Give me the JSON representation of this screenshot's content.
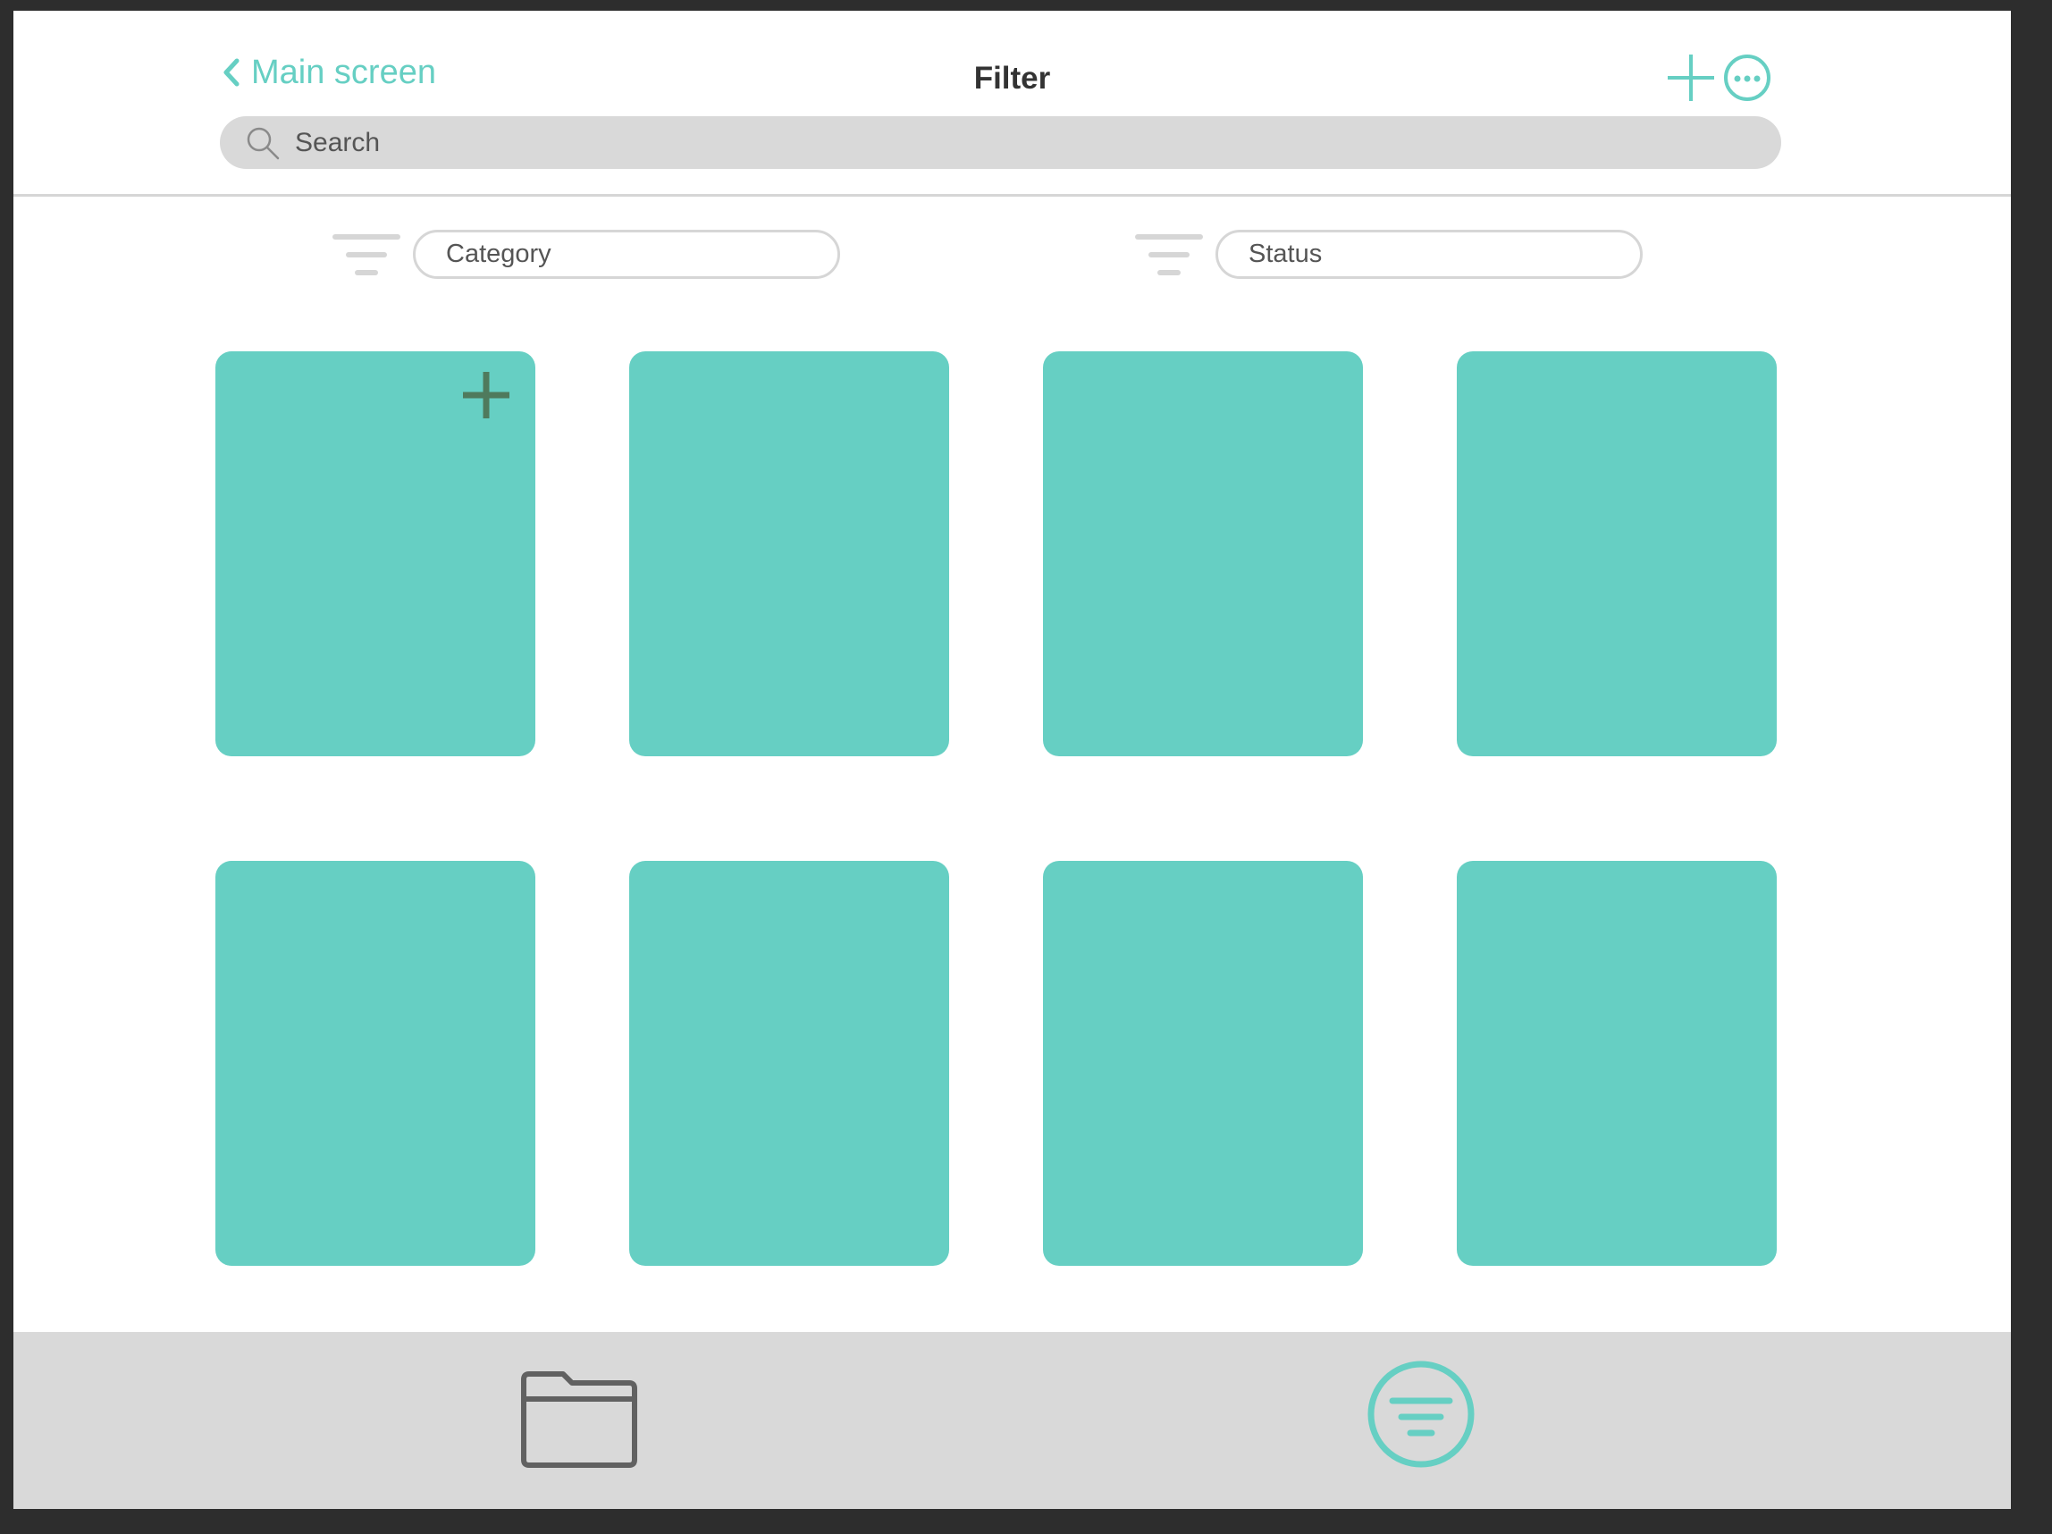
{
  "header": {
    "back_label": "Main screen",
    "title": "Filter",
    "icons": {
      "back": "chevron-left-icon",
      "add": "plus-icon",
      "more": "more-options-icon"
    }
  },
  "search": {
    "placeholder": "Search",
    "icon": "search-icon"
  },
  "filters": [
    {
      "label": "Category",
      "icon": "filter-icon"
    },
    {
      "label": "Status",
      "icon": "filter-icon"
    }
  ],
  "cards": {
    "count": 8,
    "first_card_icon": "plus-icon"
  },
  "bottom_nav": {
    "tabs": [
      {
        "icon": "folder-icon",
        "active": false
      },
      {
        "icon": "filter-circle-icon",
        "active": true
      }
    ]
  },
  "colors": {
    "accent": "#66cfc3",
    "card": "#66cfc3",
    "card_icon": "#4f7a5d",
    "search_bg": "#d9d9d9",
    "bottom_bar": "#d9d9d9",
    "inactive_icon": "#616161",
    "title_text": "#333333",
    "frame_bg": "#2d2d2d"
  }
}
